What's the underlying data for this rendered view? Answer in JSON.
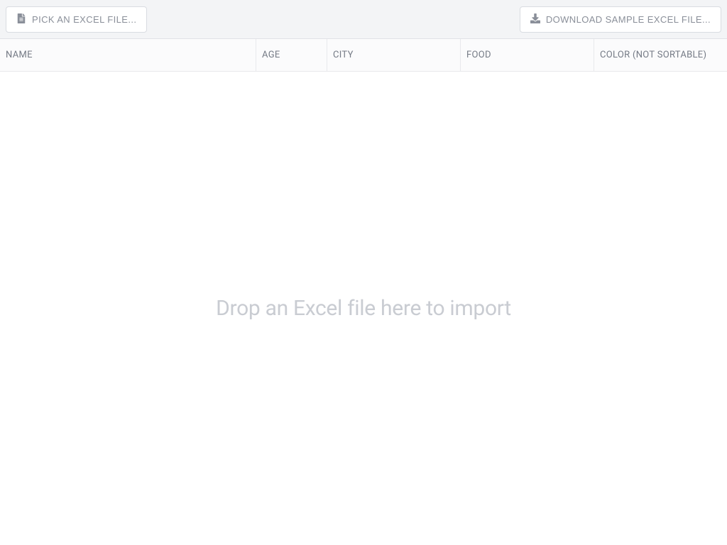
{
  "toolbar": {
    "pick_label": "PICK AN EXCEL FILE...",
    "download_label": "DOWNLOAD SAMPLE EXCEL FILE..."
  },
  "table": {
    "columns": {
      "name": "NAME",
      "age": "AGE",
      "city": "CITY",
      "food": "FOOD",
      "color": "COLOR (NOT SORTABLE)"
    }
  },
  "dropzone": {
    "message": "Drop an Excel file here to import"
  }
}
